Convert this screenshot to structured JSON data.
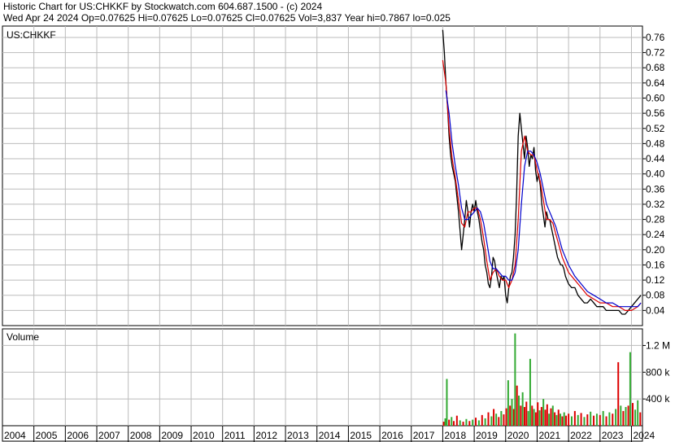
{
  "header": {
    "line1": "Historic Chart for US:CHKKF by Stockwatch.com 604.687.1500 - (c) 2024",
    "line2": "Wed Apr 24 2024   Op=0.07625   Hi=0.07625   Lo=0.07625   Cl=0.07625   Vol=3,837   Year hi=0.7867   lo=0.025"
  },
  "chart_data": [
    {
      "type": "line",
      "title": "US:CHKKF",
      "ylim": [
        0,
        0.79
      ],
      "y_ticks": [
        "0.76",
        "0.72",
        "0.68",
        "0.64",
        "0.60",
        "0.56",
        "0.52",
        "0.48",
        "0.44",
        "0.40",
        "0.36",
        "0.32",
        "0.28",
        "0.24",
        "0.20",
        "0.16",
        "0.12",
        "0.08",
        "0.04"
      ],
      "x_labels": [
        "2004",
        "2005",
        "2006",
        "2007",
        "2008",
        "2009",
        "2010",
        "2011",
        "2012",
        "2013",
        "2014",
        "2015",
        "2016",
        "2017",
        "2018",
        "2019",
        "2020",
        "2021",
        "2022",
        "2023",
        "2024"
      ],
      "xlim": [
        2004.0,
        2024.35
      ],
      "grid": true,
      "series": [
        {
          "color": "#000000",
          "x": [
            2018.0,
            2018.05,
            2018.1,
            2018.15,
            2018.2,
            2018.25,
            2018.3,
            2018.35,
            2018.4,
            2018.45,
            2018.5,
            2018.55,
            2018.6,
            2018.65,
            2018.7,
            2018.75,
            2018.8,
            2018.85,
            2018.9,
            2018.95,
            2019.0,
            2019.05,
            2019.1,
            2019.15,
            2019.2,
            2019.25,
            2019.3,
            2019.35,
            2019.4,
            2019.45,
            2019.5,
            2019.55,
            2019.6,
            2019.65,
            2019.7,
            2019.75,
            2019.8,
            2019.85,
            2019.9,
            2019.95,
            2020.0,
            2020.05,
            2020.1,
            2020.15,
            2020.2,
            2020.25,
            2020.3,
            2020.35,
            2020.4,
            2020.45,
            2020.5,
            2020.55,
            2020.6,
            2020.65,
            2020.7,
            2020.75,
            2020.8,
            2020.85,
            2020.9,
            2020.95,
            2021.0,
            2021.05,
            2021.1,
            2021.15,
            2021.2,
            2021.25,
            2021.3,
            2021.35,
            2021.4,
            2021.45,
            2021.5,
            2021.55,
            2021.6,
            2021.65,
            2021.7,
            2021.75,
            2021.8,
            2021.85,
            2021.9,
            2021.95,
            2022.0,
            2022.1,
            2022.2,
            2022.3,
            2022.4,
            2022.5,
            2022.6,
            2022.7,
            2022.8,
            2022.9,
            2023.0,
            2023.1,
            2023.2,
            2023.3,
            2023.4,
            2023.5,
            2023.6,
            2023.7,
            2023.8,
            2023.9,
            2024.0,
            2024.1,
            2024.2,
            2024.3
          ],
          "values": [
            0.78,
            0.72,
            0.64,
            0.58,
            0.5,
            0.45,
            0.42,
            0.4,
            0.38,
            0.34,
            0.3,
            0.25,
            0.2,
            0.24,
            0.28,
            0.33,
            0.3,
            0.26,
            0.3,
            0.32,
            0.3,
            0.33,
            0.3,
            0.28,
            0.25,
            0.22,
            0.2,
            0.16,
            0.14,
            0.11,
            0.1,
            0.13,
            0.18,
            0.17,
            0.14,
            0.12,
            0.1,
            0.13,
            0.12,
            0.13,
            0.08,
            0.06,
            0.1,
            0.13,
            0.14,
            0.18,
            0.24,
            0.35,
            0.5,
            0.56,
            0.52,
            0.48,
            0.44,
            0.5,
            0.47,
            0.42,
            0.45,
            0.44,
            0.47,
            0.41,
            0.38,
            0.4,
            0.37,
            0.32,
            0.29,
            0.26,
            0.3,
            0.28,
            0.28,
            0.26,
            0.24,
            0.22,
            0.2,
            0.18,
            0.17,
            0.16,
            0.16,
            0.15,
            0.13,
            0.12,
            0.11,
            0.1,
            0.1,
            0.08,
            0.07,
            0.06,
            0.06,
            0.07,
            0.06,
            0.05,
            0.05,
            0.05,
            0.04,
            0.04,
            0.04,
            0.04,
            0.04,
            0.03,
            0.03,
            0.04,
            0.05,
            0.06,
            0.07,
            0.08
          ]
        },
        {
          "color": "#dd0000",
          "x": [
            2018.0,
            2018.1,
            2018.2,
            2018.3,
            2018.4,
            2018.5,
            2018.6,
            2018.7,
            2018.8,
            2018.9,
            2019.0,
            2019.1,
            2019.2,
            2019.3,
            2019.4,
            2019.5,
            2019.6,
            2019.7,
            2019.8,
            2019.9,
            2020.0,
            2020.1,
            2020.2,
            2020.3,
            2020.4,
            2020.5,
            2020.6,
            2020.7,
            2020.8,
            2020.9,
            2021.0,
            2021.1,
            2021.2,
            2021.3,
            2021.4,
            2021.5,
            2021.6,
            2021.7,
            2021.8,
            2021.9,
            2022.0,
            2022.2,
            2022.4,
            2022.6,
            2022.8,
            2023.0,
            2023.2,
            2023.4,
            2023.6,
            2023.8,
            2024.0,
            2024.2,
            2024.3
          ],
          "values": [
            0.7,
            0.64,
            0.52,
            0.44,
            0.39,
            0.33,
            0.27,
            0.26,
            0.3,
            0.3,
            0.31,
            0.31,
            0.28,
            0.23,
            0.17,
            0.12,
            0.14,
            0.15,
            0.13,
            0.12,
            0.12,
            0.1,
            0.12,
            0.16,
            0.28,
            0.46,
            0.5,
            0.46,
            0.45,
            0.45,
            0.41,
            0.38,
            0.33,
            0.28,
            0.28,
            0.27,
            0.24,
            0.21,
            0.18,
            0.16,
            0.14,
            0.12,
            0.1,
            0.08,
            0.07,
            0.06,
            0.06,
            0.05,
            0.05,
            0.04,
            0.04,
            0.05,
            0.06
          ]
        },
        {
          "color": "#0000cc",
          "x": [
            2018.1,
            2018.2,
            2018.3,
            2018.4,
            2018.5,
            2018.6,
            2018.7,
            2018.8,
            2018.9,
            2019.0,
            2019.1,
            2019.2,
            2019.3,
            2019.4,
            2019.5,
            2019.6,
            2019.7,
            2019.8,
            2019.9,
            2020.0,
            2020.1,
            2020.2,
            2020.3,
            2020.4,
            2020.5,
            2020.6,
            2020.7,
            2020.8,
            2020.9,
            2021.0,
            2021.1,
            2021.2,
            2021.3,
            2021.4,
            2021.5,
            2021.6,
            2021.7,
            2021.8,
            2021.9,
            2022.0,
            2022.2,
            2022.4,
            2022.6,
            2022.8,
            2023.0,
            2023.2,
            2023.4,
            2023.6,
            2023.8,
            2024.0,
            2024.2,
            2024.3
          ],
          "values": [
            0.62,
            0.56,
            0.48,
            0.42,
            0.37,
            0.31,
            0.28,
            0.28,
            0.29,
            0.3,
            0.31,
            0.3,
            0.27,
            0.22,
            0.17,
            0.15,
            0.15,
            0.14,
            0.13,
            0.13,
            0.12,
            0.12,
            0.14,
            0.2,
            0.32,
            0.42,
            0.46,
            0.46,
            0.45,
            0.43,
            0.4,
            0.36,
            0.32,
            0.3,
            0.28,
            0.26,
            0.23,
            0.2,
            0.18,
            0.16,
            0.13,
            0.11,
            0.09,
            0.08,
            0.07,
            0.06,
            0.06,
            0.05,
            0.05,
            0.05,
            0.05,
            0.06
          ]
        }
      ]
    },
    {
      "type": "bar",
      "title": "Volume",
      "ylim": [
        0,
        1400000
      ],
      "y_ticks": [
        {
          "label": "1.2 M",
          "value": 1200000
        },
        {
          "label": "800 k",
          "value": 800000
        },
        {
          "label": "400 k",
          "value": 400000
        }
      ],
      "bars": [
        {
          "x": 2018.03,
          "v": 60000,
          "c": "#dd0000"
        },
        {
          "x": 2018.08,
          "v": 110000,
          "c": "#33aa33"
        },
        {
          "x": 2018.13,
          "v": 700000,
          "c": "#33aa33"
        },
        {
          "x": 2018.2,
          "v": 90000,
          "c": "#dd0000"
        },
        {
          "x": 2018.28,
          "v": 130000,
          "c": "#33aa33"
        },
        {
          "x": 2018.35,
          "v": 70000,
          "c": "#dd0000"
        },
        {
          "x": 2018.45,
          "v": 150000,
          "c": "#dd0000"
        },
        {
          "x": 2018.55,
          "v": 80000,
          "c": "#33aa33"
        },
        {
          "x": 2018.65,
          "v": 60000,
          "c": "#dd0000"
        },
        {
          "x": 2018.75,
          "v": 100000,
          "c": "#33aa33"
        },
        {
          "x": 2018.85,
          "v": 70000,
          "c": "#dd0000"
        },
        {
          "x": 2018.95,
          "v": 90000,
          "c": "#33aa33"
        },
        {
          "x": 2019.05,
          "v": 120000,
          "c": "#dd0000"
        },
        {
          "x": 2019.15,
          "v": 80000,
          "c": "#33aa33"
        },
        {
          "x": 2019.25,
          "v": 160000,
          "c": "#dd0000"
        },
        {
          "x": 2019.35,
          "v": 110000,
          "c": "#33aa33"
        },
        {
          "x": 2019.45,
          "v": 200000,
          "c": "#dd0000"
        },
        {
          "x": 2019.55,
          "v": 140000,
          "c": "#33aa33"
        },
        {
          "x": 2019.62,
          "v": 250000,
          "c": "#dd0000"
        },
        {
          "x": 2019.7,
          "v": 180000,
          "c": "#33aa33"
        },
        {
          "x": 2019.78,
          "v": 130000,
          "c": "#dd0000"
        },
        {
          "x": 2019.86,
          "v": 220000,
          "c": "#33aa33"
        },
        {
          "x": 2019.94,
          "v": 170000,
          "c": "#dd0000"
        },
        {
          "x": 2020.02,
          "v": 260000,
          "c": "#dd0000"
        },
        {
          "x": 2020.08,
          "v": 680000,
          "c": "#33aa33"
        },
        {
          "x": 2020.14,
          "v": 300000,
          "c": "#dd0000"
        },
        {
          "x": 2020.2,
          "v": 400000,
          "c": "#33aa33"
        },
        {
          "x": 2020.26,
          "v": 250000,
          "c": "#dd0000"
        },
        {
          "x": 2020.3,
          "v": 1380000,
          "c": "#33aa33"
        },
        {
          "x": 2020.36,
          "v": 600000,
          "c": "#dd0000"
        },
        {
          "x": 2020.42,
          "v": 450000,
          "c": "#33aa33"
        },
        {
          "x": 2020.48,
          "v": 300000,
          "c": "#dd0000"
        },
        {
          "x": 2020.54,
          "v": 500000,
          "c": "#33aa33"
        },
        {
          "x": 2020.6,
          "v": 280000,
          "c": "#dd0000"
        },
        {
          "x": 2020.66,
          "v": 360000,
          "c": "#dd0000"
        },
        {
          "x": 2020.72,
          "v": 220000,
          "c": "#33aa33"
        },
        {
          "x": 2020.78,
          "v": 1000000,
          "c": "#33aa33"
        },
        {
          "x": 2020.84,
          "v": 300000,
          "c": "#dd0000"
        },
        {
          "x": 2020.9,
          "v": 250000,
          "c": "#33aa33"
        },
        {
          "x": 2020.96,
          "v": 200000,
          "c": "#dd0000"
        },
        {
          "x": 2021.02,
          "v": 350000,
          "c": "#dd0000"
        },
        {
          "x": 2021.08,
          "v": 230000,
          "c": "#33aa33"
        },
        {
          "x": 2021.14,
          "v": 280000,
          "c": "#dd0000"
        },
        {
          "x": 2021.2,
          "v": 400000,
          "c": "#33aa33"
        },
        {
          "x": 2021.26,
          "v": 240000,
          "c": "#dd0000"
        },
        {
          "x": 2021.32,
          "v": 320000,
          "c": "#dd0000"
        },
        {
          "x": 2021.38,
          "v": 180000,
          "c": "#33aa33"
        },
        {
          "x": 2021.44,
          "v": 260000,
          "c": "#dd0000"
        },
        {
          "x": 2021.5,
          "v": 300000,
          "c": "#33aa33"
        },
        {
          "x": 2021.56,
          "v": 200000,
          "c": "#dd0000"
        },
        {
          "x": 2021.62,
          "v": 160000,
          "c": "#33aa33"
        },
        {
          "x": 2021.68,
          "v": 240000,
          "c": "#dd0000"
        },
        {
          "x": 2021.74,
          "v": 180000,
          "c": "#33aa33"
        },
        {
          "x": 2021.8,
          "v": 140000,
          "c": "#dd0000"
        },
        {
          "x": 2021.86,
          "v": 200000,
          "c": "#33aa33"
        },
        {
          "x": 2021.92,
          "v": 150000,
          "c": "#dd0000"
        },
        {
          "x": 2022.0,
          "v": 180000,
          "c": "#dd0000"
        },
        {
          "x": 2022.1,
          "v": 140000,
          "c": "#33aa33"
        },
        {
          "x": 2022.2,
          "v": 220000,
          "c": "#dd0000"
        },
        {
          "x": 2022.3,
          "v": 160000,
          "c": "#33aa33"
        },
        {
          "x": 2022.4,
          "v": 190000,
          "c": "#dd0000"
        },
        {
          "x": 2022.5,
          "v": 130000,
          "c": "#33aa33"
        },
        {
          "x": 2022.6,
          "v": 170000,
          "c": "#dd0000"
        },
        {
          "x": 2022.7,
          "v": 210000,
          "c": "#33aa33"
        },
        {
          "x": 2022.8,
          "v": 150000,
          "c": "#dd0000"
        },
        {
          "x": 2022.9,
          "v": 180000,
          "c": "#33aa33"
        },
        {
          "x": 2023.0,
          "v": 160000,
          "c": "#dd0000"
        },
        {
          "x": 2023.1,
          "v": 220000,
          "c": "#33aa33"
        },
        {
          "x": 2023.2,
          "v": 140000,
          "c": "#dd0000"
        },
        {
          "x": 2023.3,
          "v": 200000,
          "c": "#33aa33"
        },
        {
          "x": 2023.4,
          "v": 180000,
          "c": "#dd0000"
        },
        {
          "x": 2023.5,
          "v": 250000,
          "c": "#33aa33"
        },
        {
          "x": 2023.58,
          "v": 950000,
          "c": "#dd0000"
        },
        {
          "x": 2023.66,
          "v": 300000,
          "c": "#33aa33"
        },
        {
          "x": 2023.74,
          "v": 220000,
          "c": "#dd0000"
        },
        {
          "x": 2023.82,
          "v": 280000,
          "c": "#33aa33"
        },
        {
          "x": 2023.9,
          "v": 300000,
          "c": "#dd0000"
        },
        {
          "x": 2023.96,
          "v": 1100000,
          "c": "#33aa33"
        },
        {
          "x": 2024.04,
          "v": 340000,
          "c": "#dd0000"
        },
        {
          "x": 2024.12,
          "v": 240000,
          "c": "#33aa33"
        },
        {
          "x": 2024.2,
          "v": 380000,
          "c": "#33aa33"
        },
        {
          "x": 2024.28,
          "v": 200000,
          "c": "#dd0000"
        }
      ]
    }
  ]
}
